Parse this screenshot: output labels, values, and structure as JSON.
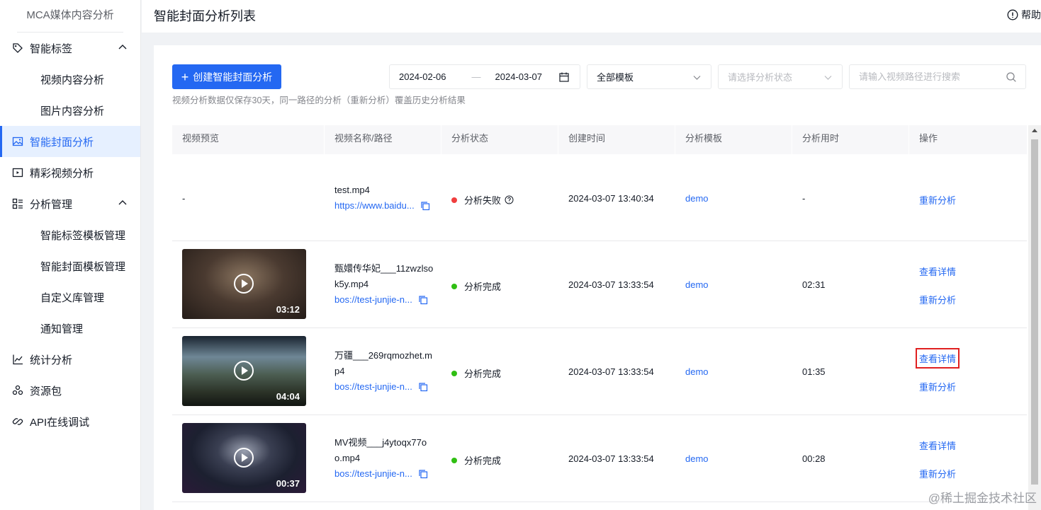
{
  "sidebar": {
    "brand": "MCA媒体内容分析",
    "items": [
      {
        "label": "智能标签",
        "icon": "tag-icon",
        "expandable": true
      },
      {
        "label": "视频内容分析",
        "sub": true
      },
      {
        "label": "图片内容分析",
        "sub": true
      },
      {
        "label": "智能封面分析",
        "icon": "image-icon",
        "active": true
      },
      {
        "label": "精彩视频分析",
        "icon": "video-icon"
      },
      {
        "label": "分析管理",
        "icon": "manage-icon",
        "expandable": true
      },
      {
        "label": "智能标签模板管理",
        "sub": true
      },
      {
        "label": "智能封面模板管理",
        "sub": true
      },
      {
        "label": "自定义库管理",
        "sub": true
      },
      {
        "label": "通知管理",
        "sub": true
      },
      {
        "label": "统计分析",
        "icon": "chart-icon"
      },
      {
        "label": "资源包",
        "icon": "package-icon"
      },
      {
        "label": "API在线调试",
        "icon": "link-icon"
      }
    ]
  },
  "header": {
    "title": "智能封面分析列表",
    "help": "帮助"
  },
  "toolbar": {
    "create_label": "创建智能封面分析",
    "hint": "视频分析数据仅保存30天，同一路径的分析（重新分析）覆盖历史分析结果",
    "date_start": "2024-02-06",
    "date_sep": "—",
    "date_end": "2024-03-07",
    "template_value": "全部模板",
    "status_placeholder": "请选择分析状态",
    "search_placeholder": "请输入视频路径进行搜索"
  },
  "table": {
    "columns": [
      "视频预览",
      "视频名称/路径",
      "分析状态",
      "创建时间",
      "分析模板",
      "分析用时",
      "操作"
    ],
    "rows": [
      {
        "preview": "-",
        "name": "test.mp4",
        "path": "https://www.baidu...",
        "status": "分析失败",
        "status_color": "#f03e3e",
        "created": "2024-03-07 13:40:34",
        "template": "demo",
        "duration": "-",
        "ops": [
          "重新分析"
        ]
      },
      {
        "preview_duration": "03:12",
        "name": "甄嬛传华妃___11zwzlsok5y.mp4",
        "path": "bos://test-junjie-n...",
        "status": "分析完成",
        "status_color": "#30bf13",
        "created": "2024-03-07 13:33:54",
        "template": "demo",
        "duration": "02:31",
        "ops": [
          "查看详情",
          "重新分析"
        ]
      },
      {
        "preview_duration": "04:04",
        "name": "万疆___269rqmozhet.mp4",
        "path": "bos://test-junjie-n...",
        "status": "分析完成",
        "status_color": "#30bf13",
        "created": "2024-03-07 13:33:54",
        "template": "demo",
        "duration": "01:35",
        "ops": [
          "查看详情",
          "重新分析"
        ]
      },
      {
        "preview_duration": "00:37",
        "name": "MV视频___j4ytoqx77oo.mp4",
        "path": "bos://test-junjie-n...",
        "status": "分析完成",
        "status_color": "#30bf13",
        "created": "2024-03-07 13:33:54",
        "template": "demo",
        "duration": "00:28",
        "ops": [
          "查看详情",
          "重新分析"
        ]
      }
    ]
  },
  "watermark": "@稀土掘金技术社区",
  "colors": {
    "primary": "#2468f2",
    "success": "#30bf13",
    "error": "#f03e3e"
  }
}
